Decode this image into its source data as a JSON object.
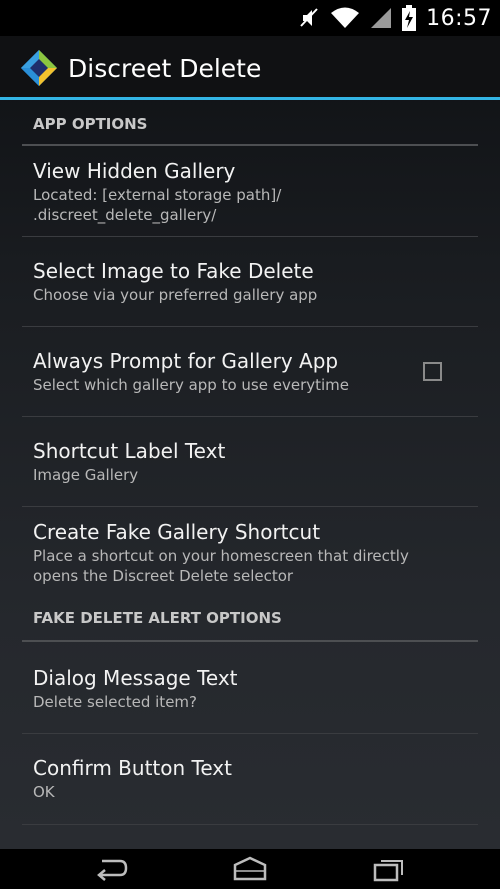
{
  "status_bar": {
    "time": "16:57",
    "icons": [
      "mute-icon",
      "wifi-icon",
      "signal-icon",
      "battery-charging-icon"
    ]
  },
  "action_bar": {
    "title": "Discreet Delete",
    "icon": "app-logo-icon"
  },
  "sections": {
    "app_options": {
      "header": "APP OPTIONS",
      "items": [
        {
          "title": "View Hidden Gallery",
          "summary_line1": "Located: [external storage path]/",
          "summary_line2": ".discreet_delete_gallery/"
        },
        {
          "title": "Select Image to Fake Delete",
          "summary": "Choose via your preferred gallery app"
        },
        {
          "title": "Always Prompt for Gallery App",
          "summary": "Select which gallery app to use everytime",
          "checked": false
        },
        {
          "title": "Shortcut Label Text",
          "summary": "Image Gallery"
        },
        {
          "title": "Create Fake Gallery Shortcut",
          "summary_line1": "Place a shortcut on your homescreen that directly",
          "summary_line2": "opens the Discreet Delete selector"
        }
      ]
    },
    "fake_delete_alert_options": {
      "header": "FAKE DELETE ALERT OPTIONS",
      "items": [
        {
          "title": "Dialog Message Text",
          "summary": "Delete selected item?"
        },
        {
          "title": "Confirm Button Text",
          "summary": "OK"
        }
      ]
    }
  },
  "nav_bar": {
    "buttons": [
      "back-icon",
      "home-icon",
      "recents-icon"
    ]
  },
  "colors": {
    "accent": "#33b5e5",
    "logo_blue": "#2a8fd8",
    "logo_green": "#8cc63f",
    "logo_yellow": "#f2c12e",
    "logo_dark": "#1f2f6b"
  }
}
